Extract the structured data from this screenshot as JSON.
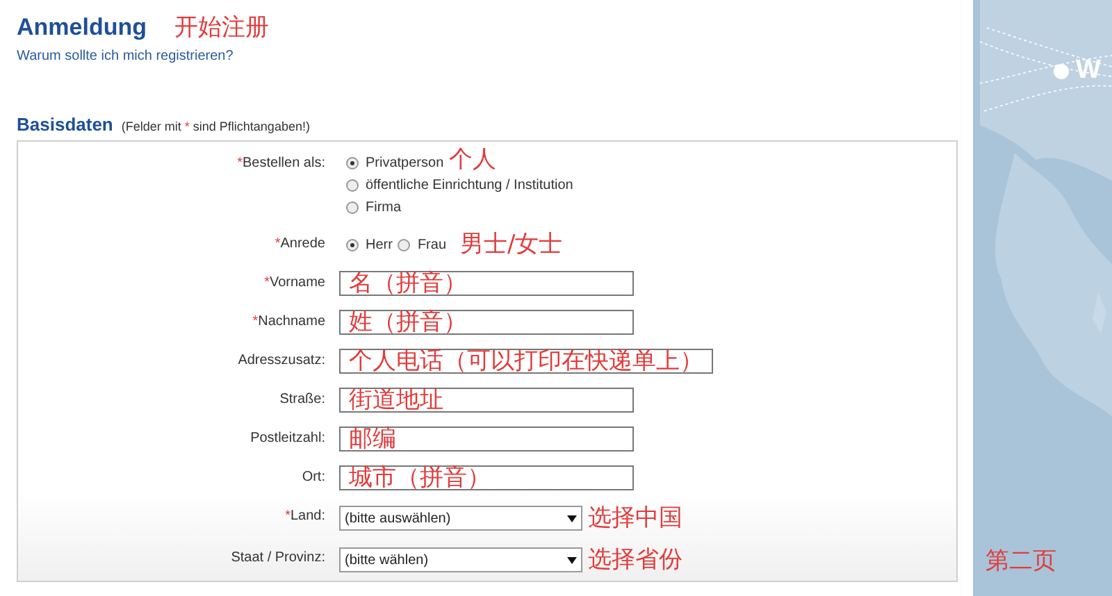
{
  "header": {
    "title": "Anmeldung",
    "annotation": "开始注册",
    "link": "Warum sollte ich mich registrieren?"
  },
  "section": {
    "title": "Basisdaten",
    "note_start": "(Felder mit ",
    "note_mark": "*",
    "note_end": " sind Pflichtangaben!)"
  },
  "rows": [
    {
      "kind": "radio-stack",
      "label": "Bestellen als:",
      "required_mark": "*",
      "annotation": "个人",
      "options": [
        {
          "label": "Privatperson",
          "selected": true
        },
        {
          "label": "öffentliche Einrichtung / Institution",
          "selected": false
        },
        {
          "label": "Firma",
          "selected": false
        }
      ]
    },
    {
      "kind": "radio-inline",
      "label": "Anrede",
      "required_mark": "*",
      "annotation": "男士/女士",
      "options": [
        {
          "label": "Herr",
          "selected": true
        },
        {
          "label": "Frau",
          "selected": false
        }
      ]
    },
    {
      "kind": "text",
      "label": "Vorname",
      "required_mark": "*",
      "annotation": "名（拼音）"
    },
    {
      "kind": "text",
      "label": "Nachname",
      "required_mark": "*",
      "annotation": "姓（拼音）"
    },
    {
      "kind": "text",
      "label": "Adresszusatz:",
      "annotation": "个人电话（可以打印在快递单上）"
    },
    {
      "kind": "text",
      "label": "Straße:",
      "annotation": "街道地址"
    },
    {
      "kind": "text",
      "label": "Postleitzahl:",
      "annotation": "邮编"
    },
    {
      "kind": "text",
      "label": "Ort:",
      "annotation": "城市（拼音）"
    },
    {
      "kind": "select",
      "label": "Land:",
      "required_mark": "*",
      "value": "(bitte auswählen)",
      "annotation": "选择中国"
    },
    {
      "kind": "select",
      "label": "Staat / Provinz:",
      "value": "(bitte wählen)",
      "annotation": "选择省份"
    }
  ],
  "side_panel": {
    "map_label": "W",
    "annotation": "第二页"
  }
}
